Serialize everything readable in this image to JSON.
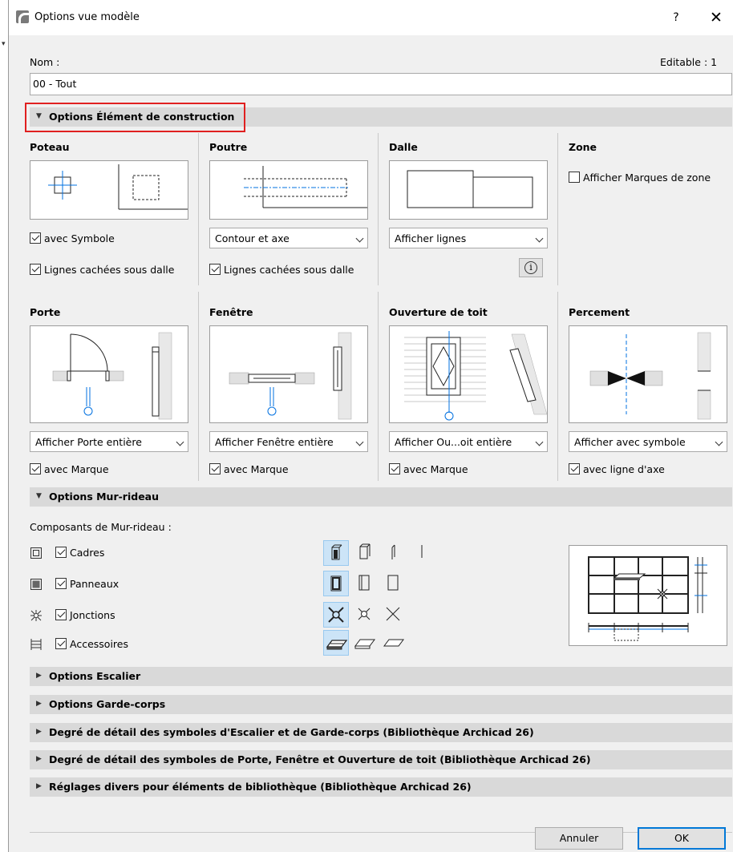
{
  "window": {
    "title": "Options vue modèle",
    "help": "?",
    "close": "✕"
  },
  "header": {
    "name_label": "Nom :",
    "editable_label": "Editable : 1",
    "name_value": "00 - Tout"
  },
  "sections": {
    "construction": "Options Élément de construction",
    "curtain_wall": "Options Mur-rideau",
    "stair": "Options Escalier",
    "railing": "Options Garde-corps",
    "stair_detail": "Degré de détail des symboles d'Escalier et de Garde-corps (Bibliothèque Archicad 26)",
    "door_detail": "Degré de détail des symboles de Porte, Fenêtre et Ouverture de toit (Bibliothèque Archicad 26)",
    "misc": "Réglages divers pour éléments de bibliothèque (Bibliothèque Archicad 26)"
  },
  "poteau": {
    "title": "Poteau",
    "symbol_cb": "avec Symbole",
    "hidden_cb": "Lignes cachées sous dalle"
  },
  "poutre": {
    "title": "Poutre",
    "dropdown": "Contour et axe",
    "hidden_cb": "Lignes cachées sous dalle"
  },
  "dalle": {
    "title": "Dalle",
    "dropdown": "Afficher lignes",
    "info_icon": "i"
  },
  "zone": {
    "title": "Zone",
    "markers_cb": "Afficher Marques de zone"
  },
  "porte": {
    "title": "Porte",
    "dropdown": "Afficher Porte entière",
    "marker_cb": "avec Marque"
  },
  "fenetre": {
    "title": "Fenêtre",
    "dropdown": "Afficher Fenêtre entière",
    "marker_cb": "avec Marque"
  },
  "ouverture": {
    "title": "Ouverture de toit",
    "dropdown": "Afficher Ou...oit entière",
    "marker_cb": "avec Marque"
  },
  "percement": {
    "title": "Percement",
    "dropdown": "Afficher avec symbole",
    "axis_cb": "avec ligne d'axe"
  },
  "curtain": {
    "components_label": "Composants de Mur-rideau :",
    "rows": [
      {
        "label": "Cadres",
        "icon": "frame-icon"
      },
      {
        "label": "Panneaux",
        "icon": "panel-icon"
      },
      {
        "label": "Jonctions",
        "icon": "junction-icon"
      },
      {
        "label": "Accessoires",
        "icon": "accessory-icon"
      }
    ]
  },
  "buttons": {
    "cancel": "Annuler",
    "ok": "OK"
  },
  "colors": {
    "accent_blue": "#0078d7",
    "highlight_red": "#e02020",
    "selected_bg": "#cce4f7",
    "symbol_blue": "#0070e0"
  }
}
